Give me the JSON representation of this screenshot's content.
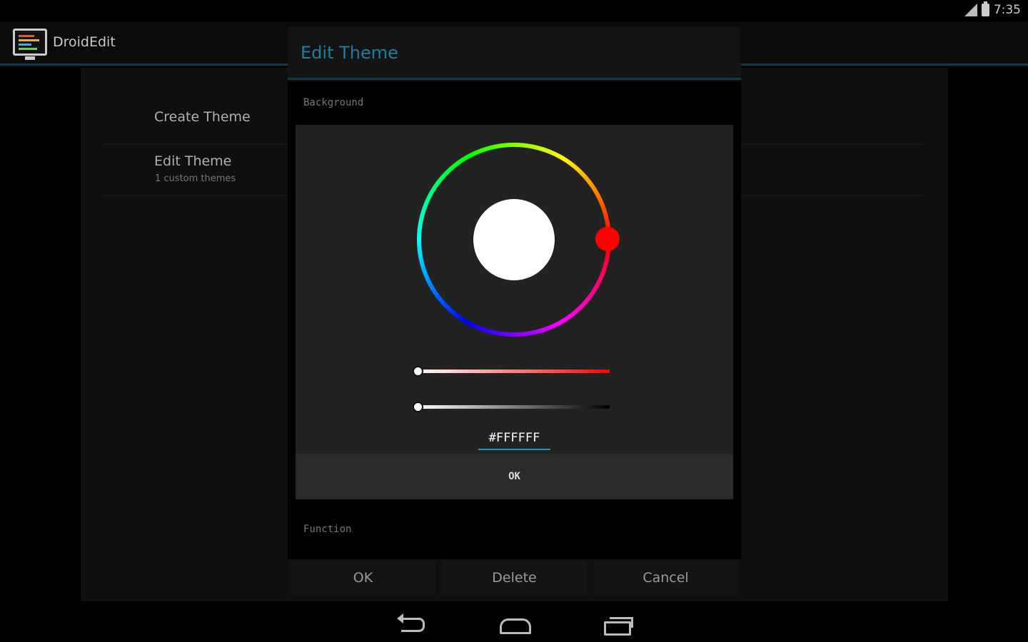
{
  "status_bar": {
    "time": "7:35",
    "signal_icon": "signal-icon",
    "battery_icon": "battery-icon"
  },
  "action_bar": {
    "app_title": "DroidEdit",
    "app_icon": "monitor-icon"
  },
  "settings": {
    "items": [
      {
        "title": "Create Theme",
        "summary": ""
      },
      {
        "title": "Edit Theme",
        "summary": "1 custom themes"
      }
    ]
  },
  "dialog": {
    "title": "Edit Theme",
    "title_color": "#1d7ea0",
    "sections": {
      "background_label": "Background",
      "function_label": "Function"
    },
    "color_picker": {
      "selected_color": "#FFFFFF",
      "hue_color": "#ff0000",
      "hex_value": "#FFFFFF",
      "ok_label": "OK"
    },
    "buttons": {
      "ok": "OK",
      "delete": "Delete",
      "cancel": "Cancel"
    }
  },
  "nav_bar": {
    "back_icon": "back-icon",
    "home_icon": "home-icon",
    "recents_icon": "recents-icon"
  }
}
